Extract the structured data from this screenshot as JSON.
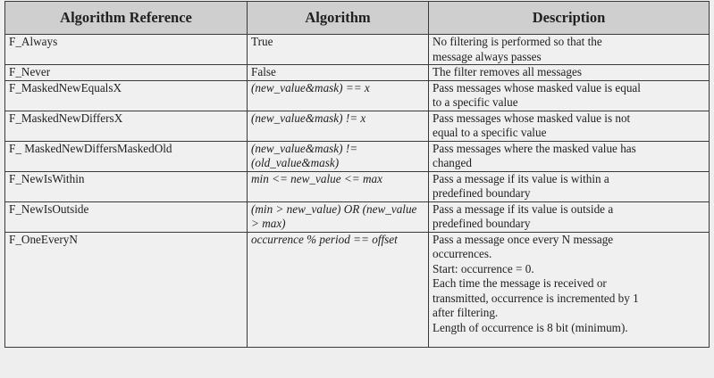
{
  "table": {
    "headers": [
      "Algorithm Reference",
      "Algorithm",
      "Description"
    ],
    "rows": [
      {
        "ref": "F_Always",
        "algorithm": "True",
        "algorithm_italic": false,
        "description": [
          "No filtering is performed so that the",
          "message always passes"
        ]
      },
      {
        "ref": "F_Never",
        "algorithm": "False",
        "algorithm_italic": false,
        "description": [
          "The filter removes all messages"
        ]
      },
      {
        "ref": "F_MaskedNewEqualsX",
        "algorithm": "(new_value&mask) == x",
        "algorithm_italic": true,
        "description": [
          "Pass messages whose masked value is equal",
          "to a specific value"
        ]
      },
      {
        "ref": "F_MaskedNewDiffersX",
        "algorithm": "(new_value&mask) != x",
        "algorithm_italic": true,
        "description": [
          "Pass messages whose masked value is not",
          "equal to a specific value"
        ]
      },
      {
        "ref": "F_ MaskedNewDiffersMaskedOld",
        "algorithm": "(new_value&mask) != (old_value&mask)",
        "algorithm_italic": true,
        "description": [
          "Pass messages where the masked value has",
          "changed"
        ]
      },
      {
        "ref": "F_NewIsWithin",
        "algorithm": "min <= new_value <= max",
        "algorithm_italic": true,
        "description": [
          "Pass a message if its value is within a",
          "predefined boundary"
        ]
      },
      {
        "ref": "F_NewIsOutside",
        "algorithm": "(min > new_value) OR (new_value > max)",
        "algorithm_italic": true,
        "description": [
          "Pass a message if its value is outside a",
          "predefined boundary"
        ]
      },
      {
        "ref": "F_OneEveryN",
        "algorithm": "occurrence % period == offset",
        "algorithm_italic": true,
        "description": [
          "Pass a message once every N message",
          "occurrences.",
          "Start: occurrence = 0.",
          "Each time the message is received or",
          "transmitted, occurrence is incremented by 1",
          "after filtering.",
          "Length of occurrence is 8 bit (minimum)."
        ]
      }
    ]
  }
}
